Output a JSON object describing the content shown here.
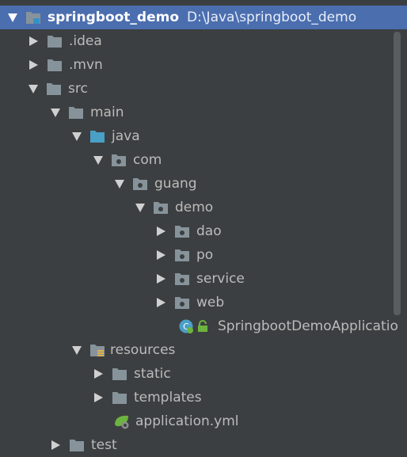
{
  "tree": {
    "root": {
      "name": "springboot_demo",
      "path": "D:\\Java\\springboot_demo"
    },
    "idea": ".idea",
    "mvn": ".mvn",
    "src": "src",
    "main": "main",
    "java": "java",
    "com": "com",
    "guang": "guang",
    "demo": "demo",
    "dao": "dao",
    "po": "po",
    "service": "service",
    "web": "web",
    "app_class": "SpringbootDemoApplicatio",
    "resources": "resources",
    "static": "static",
    "templates": "templates",
    "application_yml": "application.yml",
    "test": "test"
  },
  "colors": {
    "background": "#3c3f41",
    "selection": "#4b6eaf",
    "folder": "#87939a",
    "source_folder": "#4a9fc7",
    "spring_green": "#6db33f"
  },
  "icons": {
    "folder": "folder-icon",
    "source_folder": "source-folder-icon",
    "package": "package-icon",
    "resources_folder": "resources-folder-icon",
    "spring_boot_class": "spring-boot-class-icon",
    "lock": "lock-icon",
    "yml": "spring-yml-icon"
  }
}
